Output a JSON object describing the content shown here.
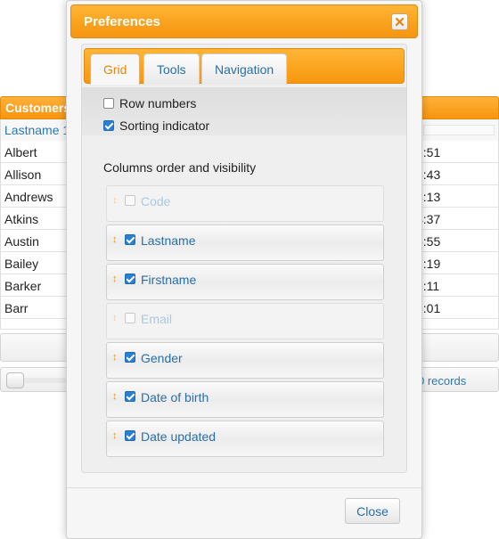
{
  "background_grid": {
    "title": "Customers",
    "column_header": "Lastname 1",
    "rows": [
      {
        "name": "Albert",
        "time": "1:51"
      },
      {
        "name": "Allison",
        "time": "3:43"
      },
      {
        "name": "Andrews",
        "time": "3:13"
      },
      {
        "name": "Atkins",
        "time": "4:37"
      },
      {
        "name": "Austin",
        "time": "5:55"
      },
      {
        "name": "Bailey",
        "time": "7:19"
      },
      {
        "name": "Barker",
        "time": "3:11"
      },
      {
        "name": "Barr",
        "time": "5:01"
      }
    ],
    "records_text": "0 records"
  },
  "dialog": {
    "title": "Preferences",
    "tabs": [
      {
        "label": "Grid",
        "active": true
      },
      {
        "label": "Tools",
        "active": false
      },
      {
        "label": "Navigation",
        "active": false
      }
    ],
    "options": [
      {
        "label": "Row numbers",
        "checked": false
      },
      {
        "label": "Sorting indicator",
        "checked": true
      }
    ],
    "columns_title": "Columns order and visibility",
    "columns": [
      {
        "label": "Code",
        "checked": false,
        "enabled": false
      },
      {
        "label": "Lastname",
        "checked": true,
        "enabled": true
      },
      {
        "label": "Firstname",
        "checked": true,
        "enabled": true
      },
      {
        "label": "Email",
        "checked": false,
        "enabled": false
      },
      {
        "label": "Gender",
        "checked": true,
        "enabled": true
      },
      {
        "label": "Date of birth",
        "checked": true,
        "enabled": true
      },
      {
        "label": "Date updated",
        "checked": true,
        "enabled": true
      }
    ],
    "close_button": "Close"
  },
  "colors": {
    "accent_orange": "#f7970f",
    "link_blue": "#2a6fa8",
    "checkbox_blue": "#2a7fd4"
  },
  "icons": {
    "close": "close-x-icon",
    "drag": "drag-handle-icon"
  }
}
